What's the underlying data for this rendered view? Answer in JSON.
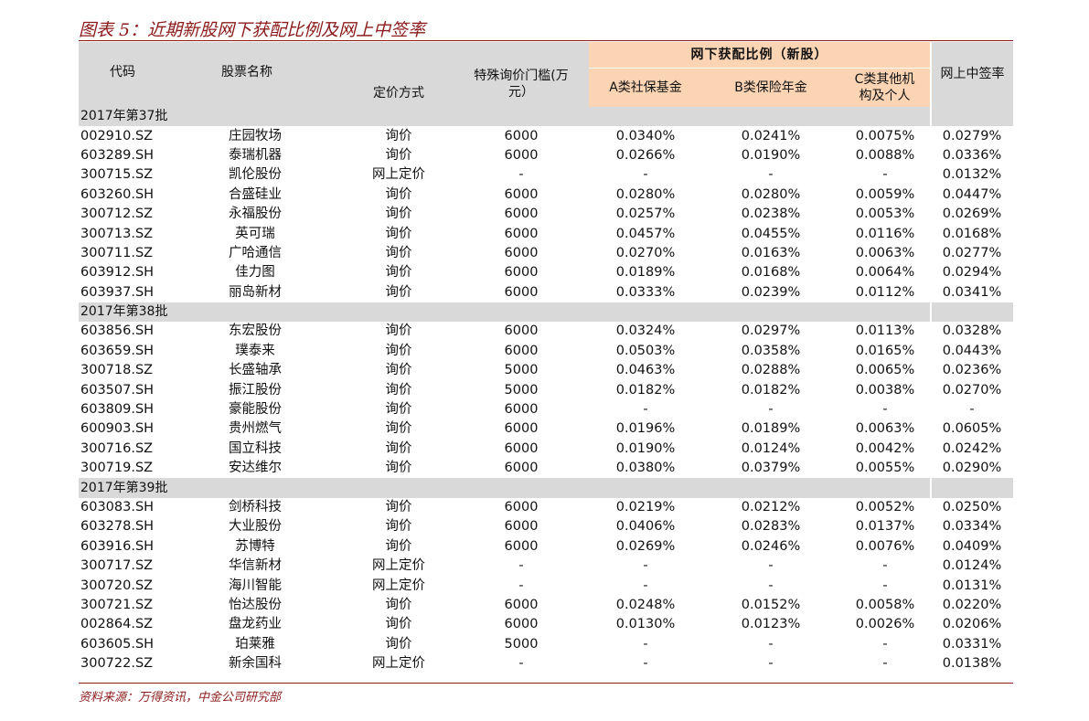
{
  "title": "图表 5：近期新股网下获配比例及网上中签率",
  "source": "资料来源：万得资讯，中金公司研究部",
  "headers": {
    "code": "代码",
    "name": "股票名称",
    "method": "定价方式",
    "threshold_line1": "特殊询价门槛(万",
    "threshold_line2": "元）",
    "group": "网下获配比例（新股）",
    "a": "A类社保基金",
    "b": "B类保险年金",
    "c_line1": "C类其他机",
    "c_line2": "构及个人",
    "online": "网上中签率"
  },
  "batches": [
    {
      "label": "2017年第37批",
      "rows": [
        [
          "002910.SZ",
          "庄园牧场",
          "询价",
          "6000",
          "0.0340%",
          "0.0241%",
          "0.0075%",
          "0.0279%"
        ],
        [
          "603289.SH",
          "泰瑞机器",
          "询价",
          "6000",
          "0.0266%",
          "0.0190%",
          "0.0088%",
          "0.0336%"
        ],
        [
          "300715.SZ",
          "凯伦股份",
          "网上定价",
          "-",
          "-",
          "-",
          "-",
          "0.0132%"
        ],
        [
          "603260.SH",
          "合盛硅业",
          "询价",
          "6000",
          "0.0280%",
          "0.0280%",
          "0.0059%",
          "0.0447%"
        ],
        [
          "300712.SZ",
          "永福股份",
          "询价",
          "6000",
          "0.0257%",
          "0.0238%",
          "0.0053%",
          "0.0269%"
        ],
        [
          "300713.SZ",
          "英可瑞",
          "询价",
          "6000",
          "0.0457%",
          "0.0455%",
          "0.0116%",
          "0.0168%"
        ],
        [
          "300711.SZ",
          "广哈通信",
          "询价",
          "6000",
          "0.0270%",
          "0.0163%",
          "0.0063%",
          "0.0277%"
        ],
        [
          "603912.SH",
          "佳力图",
          "询价",
          "6000",
          "0.0189%",
          "0.0168%",
          "0.0064%",
          "0.0294%"
        ],
        [
          "603937.SH",
          "丽岛新材",
          "询价",
          "6000",
          "0.0333%",
          "0.0239%",
          "0.0112%",
          "0.0341%"
        ]
      ]
    },
    {
      "label": "2017年第38批",
      "rows": [
        [
          "603856.SH",
          "东宏股份",
          "询价",
          "6000",
          "0.0324%",
          "0.0297%",
          "0.0113%",
          "0.0328%"
        ],
        [
          "603659.SH",
          "璞泰来",
          "询价",
          "6000",
          "0.0503%",
          "0.0358%",
          "0.0165%",
          "0.0443%"
        ],
        [
          "300718.SZ",
          "长盛轴承",
          "询价",
          "5000",
          "0.0463%",
          "0.0288%",
          "0.0065%",
          "0.0236%"
        ],
        [
          "603507.SH",
          "振江股份",
          "询价",
          "5000",
          "0.0182%",
          "0.0182%",
          "0.0038%",
          "0.0270%"
        ],
        [
          "603809.SH",
          "豪能股份",
          "询价",
          "6000",
          "-",
          "-",
          "-",
          "-"
        ],
        [
          "600903.SH",
          "贵州燃气",
          "询价",
          "6000",
          "0.0196%",
          "0.0189%",
          "0.0063%",
          "0.0605%"
        ],
        [
          "300716.SZ",
          "国立科技",
          "询价",
          "6000",
          "0.0190%",
          "0.0124%",
          "0.0042%",
          "0.0242%"
        ],
        [
          "300719.SZ",
          "安达维尔",
          "询价",
          "6000",
          "0.0380%",
          "0.0379%",
          "0.0055%",
          "0.0290%"
        ]
      ]
    },
    {
      "label": "2017年第39批",
      "rows": [
        [
          "603083.SH",
          "剑桥科技",
          "询价",
          "6000",
          "0.0219%",
          "0.0212%",
          "0.0052%",
          "0.0250%"
        ],
        [
          "603278.SH",
          "大业股份",
          "询价",
          "6000",
          "0.0406%",
          "0.0283%",
          "0.0137%",
          "0.0334%"
        ],
        [
          "603916.SH",
          "苏博特",
          "询价",
          "6000",
          "0.0269%",
          "0.0246%",
          "0.0076%",
          "0.0409%"
        ],
        [
          "300717.SZ",
          "华信新材",
          "网上定价",
          "-",
          "-",
          "-",
          "-",
          "0.0124%"
        ],
        [
          "300720.SZ",
          "海川智能",
          "网上定价",
          "-",
          "-",
          "-",
          "-",
          "0.0131%"
        ],
        [
          "300721.SZ",
          "怡达股份",
          "询价",
          "6000",
          "0.0248%",
          "0.0152%",
          "0.0058%",
          "0.0220%"
        ],
        [
          "002864.SZ",
          "盘龙药业",
          "询价",
          "6000",
          "0.0130%",
          "0.0123%",
          "0.0026%",
          "0.0206%"
        ],
        [
          "603605.SH",
          "珀莱雅",
          "询价",
          "5000",
          "-",
          "-",
          "-",
          "0.0331%"
        ],
        [
          "300722.SZ",
          "新余国科",
          "网上定价",
          "-",
          "-",
          "-",
          "-",
          "0.0138%"
        ]
      ]
    }
  ]
}
